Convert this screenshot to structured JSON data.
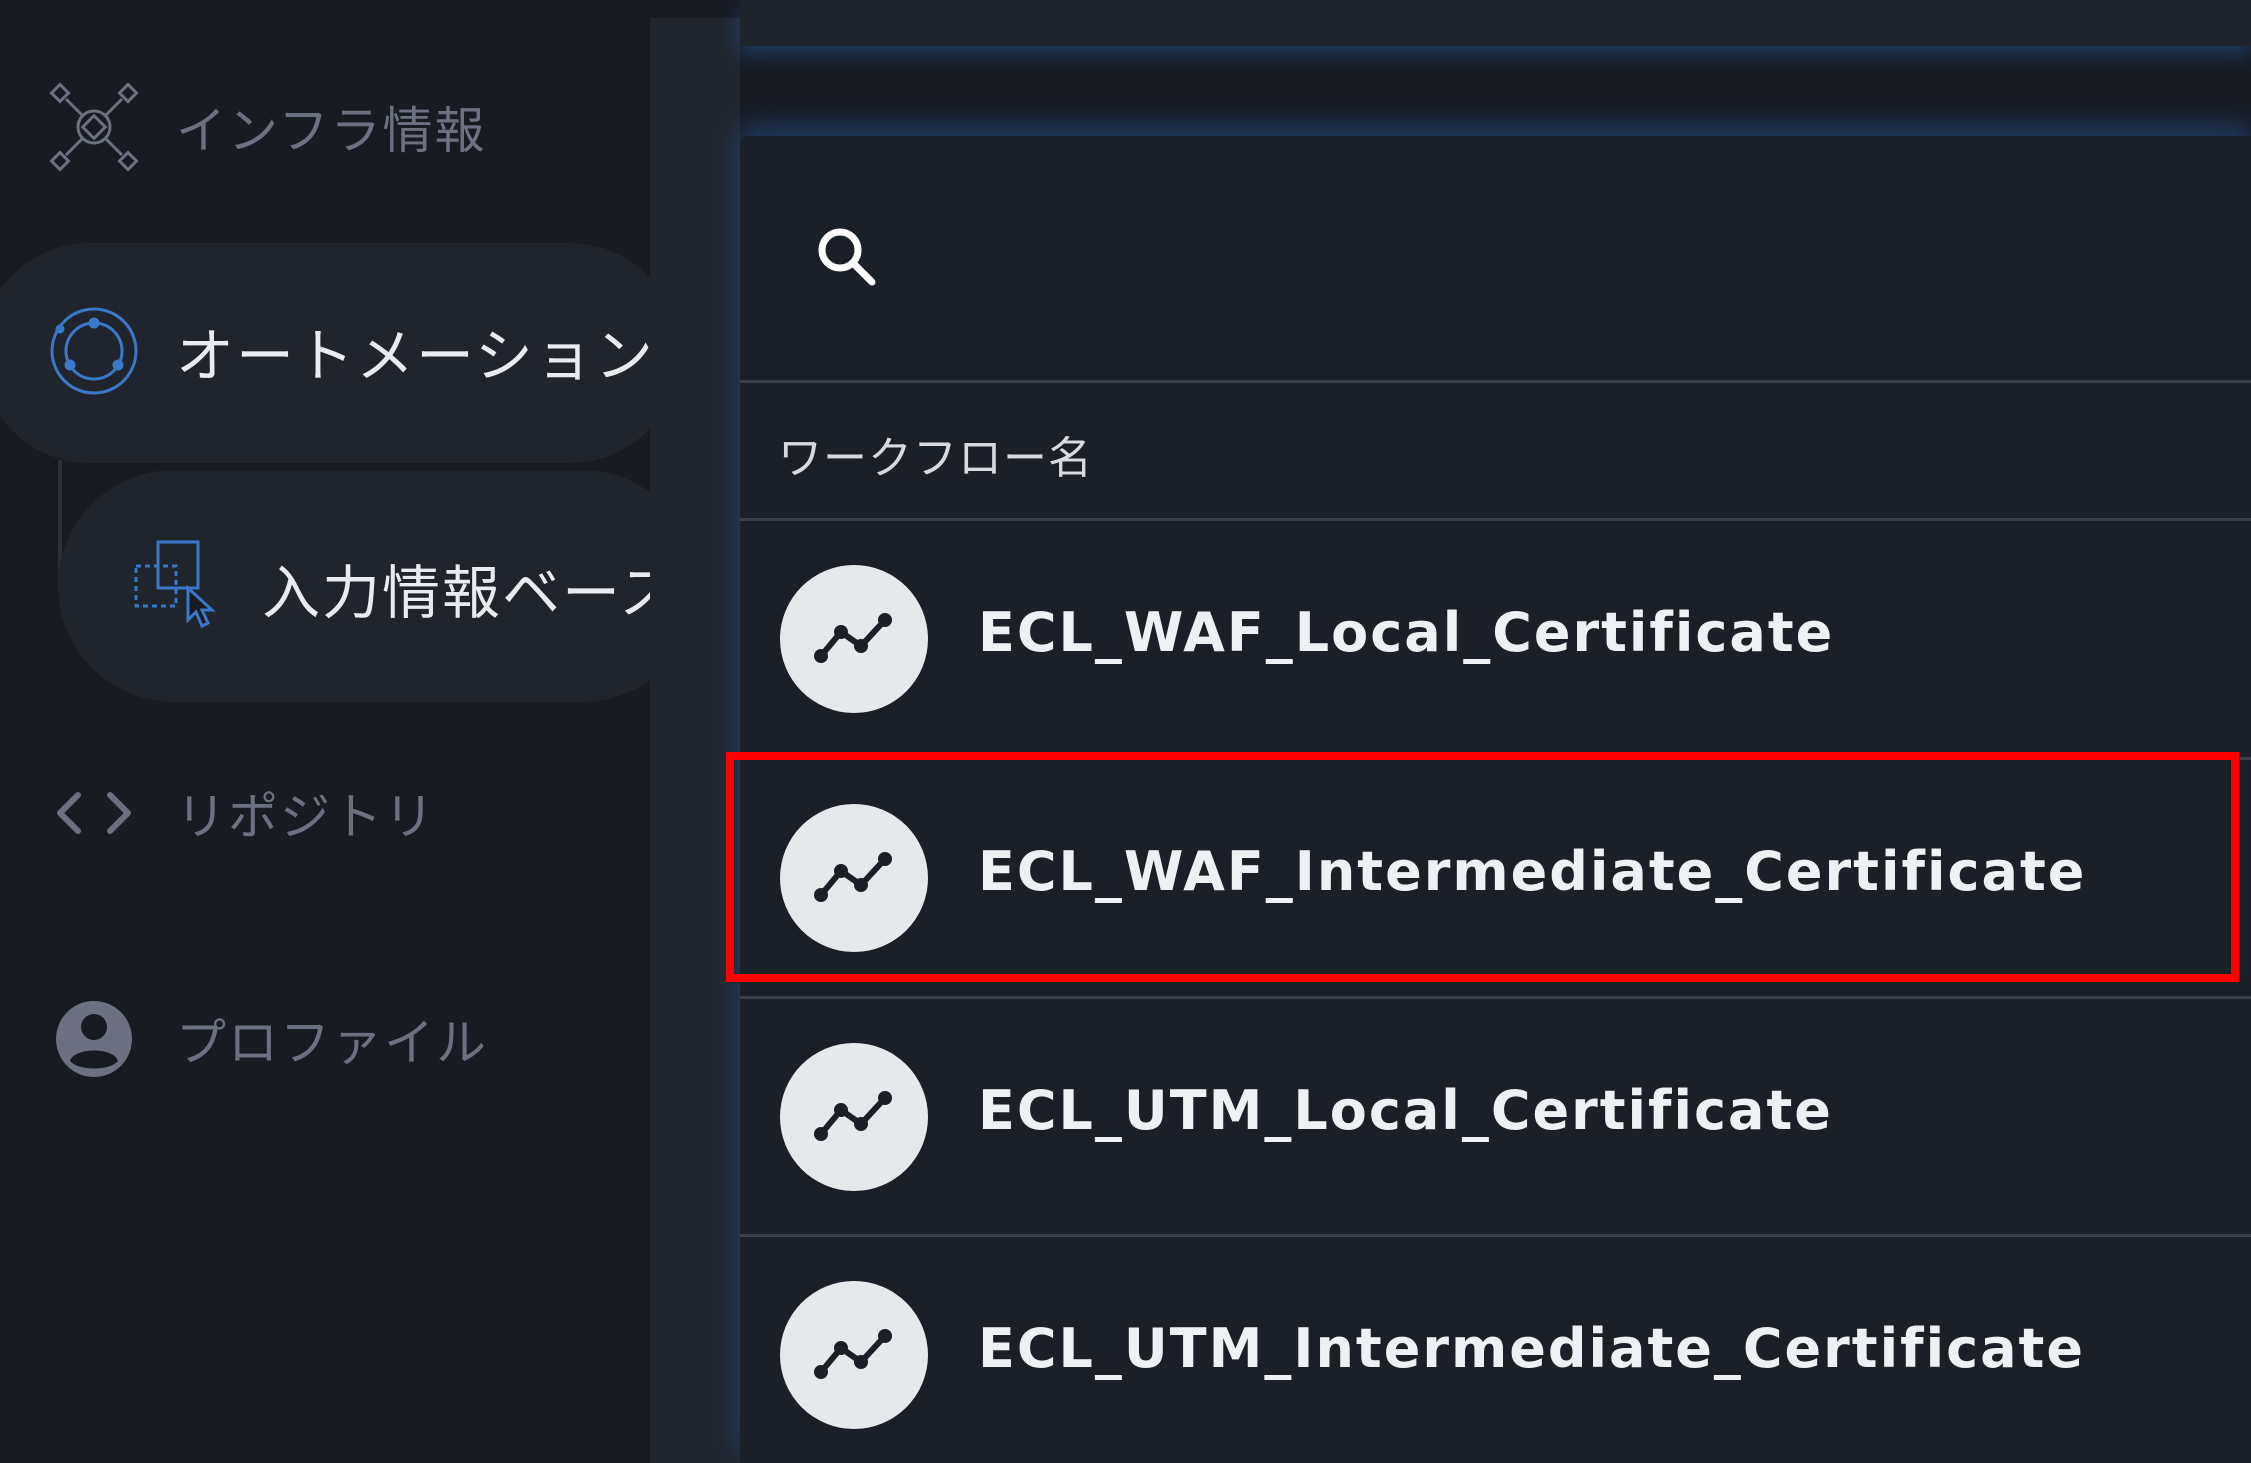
{
  "sidebar": {
    "items": [
      {
        "label": "インフラ情報",
        "icon": "network-icon"
      },
      {
        "label": "オートメーション",
        "icon": "automation-icon",
        "active": true
      },
      {
        "label": "リポジトリ",
        "icon": "code-brackets-icon"
      },
      {
        "label": "プロファイル",
        "icon": "account-icon"
      }
    ],
    "subitem": {
      "label": "入力情報ベース",
      "icon": "input-form-icon"
    }
  },
  "search": {
    "placeholder": "",
    "value": ""
  },
  "table": {
    "column_header": "ワークフロー名",
    "rows": [
      {
        "name": "ECL_WAF_Local_Certificate",
        "icon": "workflow-icon"
      },
      {
        "name": "ECL_WAF_Intermediate_Certificate",
        "icon": "workflow-icon",
        "highlighted": true
      },
      {
        "name": "ECL_UTM_Local_Certificate",
        "icon": "workflow-icon"
      },
      {
        "name": "ECL_UTM_Intermediate_Certificate",
        "icon": "workflow-icon"
      }
    ]
  },
  "colors": {
    "background": "#181b22",
    "accent_blue": "#3a78c9",
    "highlight": "#ff0000",
    "text_primary": "#eef0f3",
    "text_muted": "#6b7180"
  }
}
